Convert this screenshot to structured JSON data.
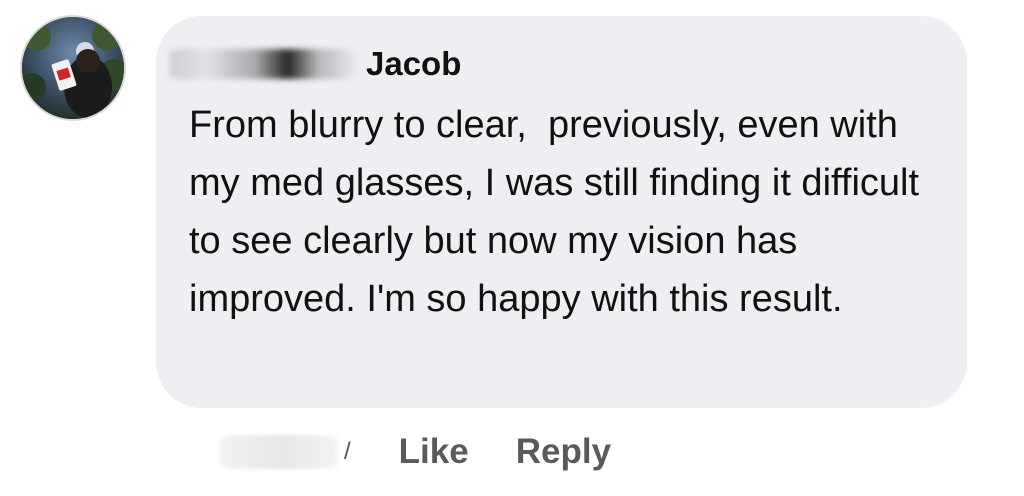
{
  "comment": {
    "author_name": "Jacob",
    "text": "From blurry to clear,  previously, even with my med glasses, I was still finding it difficult to see clearly but now my vision has improved. I'm so happy with this result."
  },
  "actions": {
    "separator": "/",
    "like_label": "Like",
    "reply_label": "Reply"
  },
  "colors": {
    "bubble_background": "#eeeff2",
    "text": "#111111",
    "action_text": "#5a5a5a"
  },
  "icons": {
    "avatar": "profile-photo"
  }
}
